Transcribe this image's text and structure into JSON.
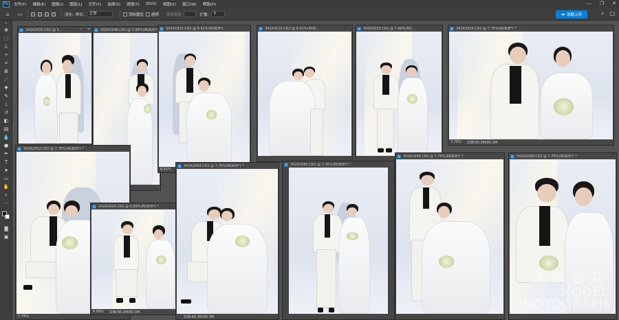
{
  "app": {
    "logo": "Ps"
  },
  "menu": [
    "文件(F)",
    "编辑(E)",
    "图像(I)",
    "图层(L)",
    "文字(Y)",
    "选择(S)",
    "滤镜(T)",
    "3D(D)",
    "视图(V)",
    "窗口(W)",
    "帮助(H)"
  ],
  "window_controls": {
    "minimize": "—",
    "maximize": "❐",
    "close": "✕"
  },
  "options": {
    "feather_label": "羽化:",
    "feather_value": "",
    "style_label": "样式:",
    "style_value": "正常",
    "antialias_label": "消除锯齿",
    "transparent_label": "透明",
    "width_label": "使用图层",
    "expand_label": "扩散:",
    "expand_value": "5",
    "cloud_button": "协助上传"
  },
  "toolbar": [
    "move-tool",
    "marquee-tool",
    "lasso-tool",
    "wand-tool",
    "crop-tool",
    "frame-tool",
    "eyedropper-tool",
    "heal-tool",
    "brush-tool",
    "stamp-tool",
    "history-tool",
    "eraser-tool",
    "gradient-tool",
    "blur-tool",
    "dodge-tool",
    "pen-tool",
    "type-tool",
    "path-select-tool",
    "shape-tool",
    "hand-tool",
    "zoom-tool",
    "more-tool"
  ],
  "documents": [
    {
      "name": "342A2035.CR2 @ 5...",
      "zoom": "",
      "size": ""
    },
    {
      "name": "342A1948.CR2 @ 7.48%(RGB/8*)",
      "zoom": "",
      "size": ""
    },
    {
      "name": "342A1931.CR2 @ 6.41%(RGB/8*)",
      "zoom": "6.41%",
      "size": ""
    },
    {
      "name": "342A2019.CR2 @ 6.41%(RGB...",
      "zoom": "",
      "size": ""
    },
    {
      "name": "342A2033.CR2 @ 7.48%(RG...",
      "zoom": "",
      "size": ""
    },
    {
      "name": "342A2034.CR2 @ 7.76%(RGB/8*) *",
      "zoom": "7.76%",
      "size": "文档:80.3M/80.3M"
    },
    {
      "name": "342A2052.CR2 @ 7.76%(RGB/8*) *",
      "zoom": "7.76%",
      "size": ""
    },
    {
      "name": "342A2024.CR2 @ 6.89%(RGB/8*) *",
      "zoom": "6.89%",
      "size": "文档:80.3M/80.3M"
    },
    {
      "name": "342A2084.CR2 @ 7.76%(RGB/8*) *",
      "zoom": "",
      "size": "文档:80.3M/80.3M"
    },
    {
      "name": "342A2082.CR2 @ 7.76%(RGB/8*) *",
      "zoom": "",
      "size": ""
    },
    {
      "name": "342A1990.CR2 @ 7.76%(RGB/8*) *",
      "zoom": "",
      "size": ""
    },
    {
      "name": "342A2080.CR2 @ 7.76%(RGB/8*) *",
      "zoom": "",
      "size": ""
    }
  ],
  "watermark": {
    "line1": "木丽安莉",
    "line2": "MODEL PHOTOGRAPH"
  }
}
